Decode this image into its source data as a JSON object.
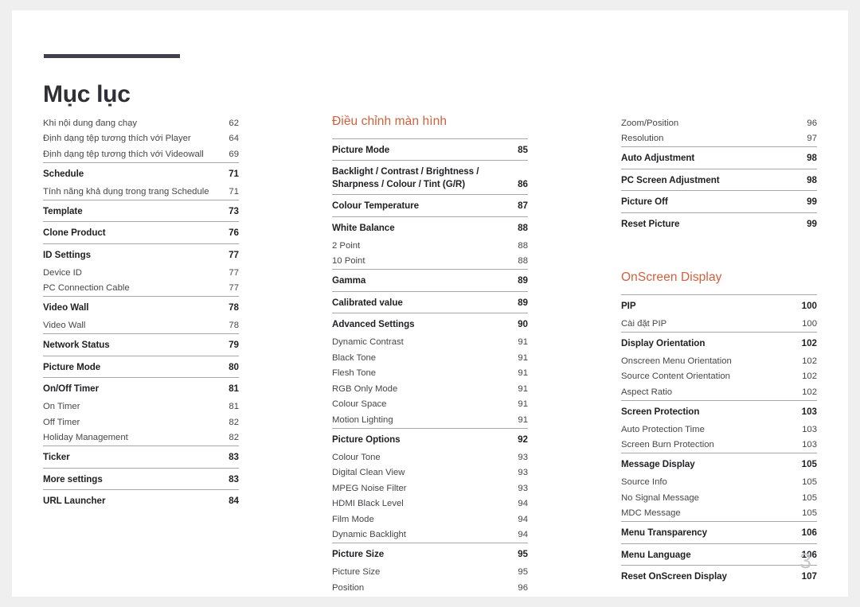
{
  "document": {
    "title": "Mục lục",
    "folio": "3",
    "accent_color": "#d0603c",
    "rule_color": "#41414d"
  },
  "columns": [
    {
      "name": "column-1",
      "heading": null,
      "groups": [
        {
          "ruled": false,
          "entries": [
            {
              "type": "sub",
              "label": "Khi nội dung đang chạy",
              "page": "62"
            },
            {
              "type": "sub",
              "label": "Định dạng tệp tương thích với Player",
              "page": "64"
            },
            {
              "type": "sub",
              "label": "Định dạng tệp tương thích với Videowall",
              "page": "69"
            }
          ]
        },
        {
          "ruled": true,
          "entries": [
            {
              "type": "main",
              "label": "Schedule",
              "page": "71"
            },
            {
              "type": "sub",
              "label": "Tính năng khả dụng trong trang Schedule",
              "page": "71"
            }
          ]
        },
        {
          "ruled": true,
          "entries": [
            {
              "type": "main",
              "label": "Template",
              "page": "73"
            }
          ]
        },
        {
          "ruled": true,
          "entries": [
            {
              "type": "main",
              "label": "Clone Product",
              "page": "76"
            }
          ]
        },
        {
          "ruled": true,
          "entries": [
            {
              "type": "main",
              "label": "ID Settings",
              "page": "77"
            },
            {
              "type": "sub",
              "label": "Device ID",
              "page": "77"
            },
            {
              "type": "sub",
              "label": "PC Connection Cable",
              "page": "77"
            }
          ]
        },
        {
          "ruled": true,
          "entries": [
            {
              "type": "main",
              "label": "Video Wall",
              "page": "78"
            },
            {
              "type": "sub",
              "label": "Video Wall",
              "page": "78"
            }
          ]
        },
        {
          "ruled": true,
          "entries": [
            {
              "type": "main",
              "label": "Network Status",
              "page": "79"
            }
          ]
        },
        {
          "ruled": true,
          "entries": [
            {
              "type": "main",
              "label": "Picture Mode",
              "page": "80"
            }
          ]
        },
        {
          "ruled": true,
          "entries": [
            {
              "type": "main",
              "label": "On/Off Timer",
              "page": "81"
            },
            {
              "type": "sub",
              "label": "On Timer",
              "page": "81"
            },
            {
              "type": "sub",
              "label": "Off Timer",
              "page": "82"
            },
            {
              "type": "sub",
              "label": "Holiday Management",
              "page": "82"
            }
          ]
        },
        {
          "ruled": true,
          "entries": [
            {
              "type": "main",
              "label": "Ticker",
              "page": "83"
            }
          ]
        },
        {
          "ruled": true,
          "entries": [
            {
              "type": "main",
              "label": "More settings",
              "page": "83"
            }
          ]
        },
        {
          "ruled": true,
          "entries": [
            {
              "type": "main",
              "label": "URL Launcher",
              "page": "84"
            }
          ]
        }
      ]
    },
    {
      "name": "column-2",
      "heading": "Điều chỉnh màn hình",
      "groups": [
        {
          "ruled": true,
          "entries": [
            {
              "type": "main",
              "label": "Picture Mode",
              "page": "85"
            }
          ]
        },
        {
          "ruled": true,
          "entries": [
            {
              "type": "main",
              "label": "Backlight / Contrast / Brightness / Sharpness / Colour / Tint (G/R)",
              "page": "86",
              "multiline": true
            }
          ]
        },
        {
          "ruled": true,
          "entries": [
            {
              "type": "main",
              "label": "Colour Temperature",
              "page": "87"
            }
          ]
        },
        {
          "ruled": true,
          "entries": [
            {
              "type": "main",
              "label": "White Balance",
              "page": "88"
            },
            {
              "type": "sub",
              "label": "2 Point",
              "page": "88"
            },
            {
              "type": "sub",
              "label": "10 Point",
              "page": "88"
            }
          ]
        },
        {
          "ruled": true,
          "entries": [
            {
              "type": "main",
              "label": "Gamma",
              "page": "89"
            }
          ]
        },
        {
          "ruled": true,
          "entries": [
            {
              "type": "main",
              "label": "Calibrated value",
              "page": "89"
            }
          ]
        },
        {
          "ruled": true,
          "entries": [
            {
              "type": "main",
              "label": "Advanced Settings",
              "page": "90"
            },
            {
              "type": "sub",
              "label": "Dynamic Contrast",
              "page": "91"
            },
            {
              "type": "sub",
              "label": "Black Tone",
              "page": "91"
            },
            {
              "type": "sub",
              "label": "Flesh Tone",
              "page": "91"
            },
            {
              "type": "sub",
              "label": "RGB Only Mode",
              "page": "91"
            },
            {
              "type": "sub",
              "label": "Colour Space",
              "page": "91"
            },
            {
              "type": "sub",
              "label": "Motion Lighting",
              "page": "91"
            }
          ]
        },
        {
          "ruled": true,
          "entries": [
            {
              "type": "main",
              "label": "Picture Options",
              "page": "92"
            },
            {
              "type": "sub",
              "label": "Colour Tone",
              "page": "93"
            },
            {
              "type": "sub",
              "label": "Digital Clean View",
              "page": "93"
            },
            {
              "type": "sub",
              "label": "MPEG Noise Filter",
              "page": "93"
            },
            {
              "type": "sub",
              "label": "HDMI Black Level",
              "page": "94"
            },
            {
              "type": "sub",
              "label": "Film Mode",
              "page": "94"
            },
            {
              "type": "sub",
              "label": "Dynamic Backlight",
              "page": "94"
            }
          ]
        },
        {
          "ruled": true,
          "entries": [
            {
              "type": "main",
              "label": "Picture Size",
              "page": "95"
            },
            {
              "type": "sub",
              "label": "Picture Size",
              "page": "95"
            },
            {
              "type": "sub",
              "label": "Position",
              "page": "96"
            }
          ]
        }
      ]
    },
    {
      "name": "column-3",
      "heading": null,
      "groups": [
        {
          "ruled": false,
          "entries": [
            {
              "type": "sub",
              "label": "Zoom/Position",
              "page": "96"
            },
            {
              "type": "sub",
              "label": "Resolution",
              "page": "97"
            }
          ]
        },
        {
          "ruled": true,
          "entries": [
            {
              "type": "main",
              "label": "Auto Adjustment",
              "page": "98"
            }
          ]
        },
        {
          "ruled": true,
          "entries": [
            {
              "type": "main",
              "label": "PC Screen Adjustment",
              "page": "98"
            }
          ]
        },
        {
          "ruled": true,
          "entries": [
            {
              "type": "main",
              "label": "Picture Off",
              "page": "99"
            }
          ]
        },
        {
          "ruled": true,
          "entries": [
            {
              "type": "main",
              "label": "Reset Picture",
              "page": "99"
            }
          ]
        }
      ],
      "second_heading": "OnScreen Display",
      "second_groups": [
        {
          "ruled": true,
          "entries": [
            {
              "type": "main",
              "label": "PIP",
              "page": "100"
            },
            {
              "type": "sub",
              "label": "Cài đặt PIP",
              "page": "100"
            }
          ]
        },
        {
          "ruled": true,
          "entries": [
            {
              "type": "main",
              "label": "Display Orientation",
              "page": "102"
            },
            {
              "type": "sub",
              "label": "Onscreen Menu Orientation",
              "page": "102"
            },
            {
              "type": "sub",
              "label": "Source Content Orientation",
              "page": "102"
            },
            {
              "type": "sub",
              "label": "Aspect Ratio",
              "page": "102"
            }
          ]
        },
        {
          "ruled": true,
          "entries": [
            {
              "type": "main",
              "label": "Screen Protection",
              "page": "103"
            },
            {
              "type": "sub",
              "label": "Auto Protection Time",
              "page": "103"
            },
            {
              "type": "sub",
              "label": "Screen Burn Protection",
              "page": "103"
            }
          ]
        },
        {
          "ruled": true,
          "entries": [
            {
              "type": "main",
              "label": "Message Display",
              "page": "105"
            },
            {
              "type": "sub",
              "label": "Source Info",
              "page": "105"
            },
            {
              "type": "sub",
              "label": "No Signal Message",
              "page": "105"
            },
            {
              "type": "sub",
              "label": "MDC Message",
              "page": "105"
            }
          ]
        },
        {
          "ruled": true,
          "entries": [
            {
              "type": "main",
              "label": "Menu Transparency",
              "page": "106"
            }
          ]
        },
        {
          "ruled": true,
          "entries": [
            {
              "type": "main",
              "label": "Menu Language",
              "page": "106"
            }
          ]
        },
        {
          "ruled": true,
          "entries": [
            {
              "type": "main",
              "label": "Reset OnScreen Display",
              "page": "107"
            }
          ]
        }
      ]
    }
  ]
}
